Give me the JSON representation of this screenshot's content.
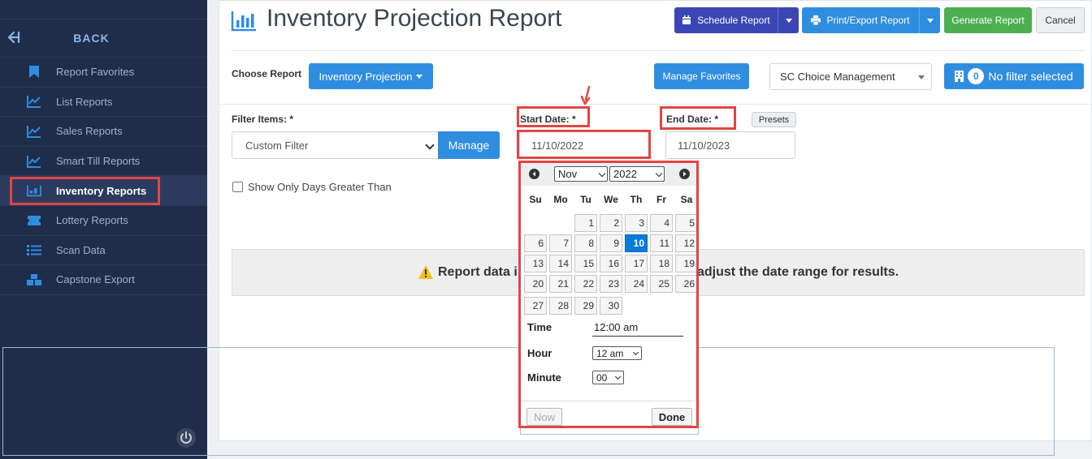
{
  "sidebar": {
    "back_label": "BACK",
    "items": [
      {
        "label": "Report Favorites",
        "icon": "bookmark-icon"
      },
      {
        "label": "List Reports",
        "icon": "line-chart-icon"
      },
      {
        "label": "Sales Reports",
        "icon": "line-chart-icon"
      },
      {
        "label": "Smart Till Reports",
        "icon": "line-chart-icon"
      },
      {
        "label": "Inventory Reports",
        "icon": "inventory-icon",
        "active": true
      },
      {
        "label": "Lottery Reports",
        "icon": "ticket-icon"
      },
      {
        "label": "Scan Data",
        "icon": "list-icon"
      },
      {
        "label": "Capstone Export",
        "icon": "boxes-icon"
      }
    ]
  },
  "header": {
    "title": "Inventory Projection Report",
    "schedule_label": "Schedule Report",
    "print_label": "Print/Export Report",
    "generate_label": "Generate Report",
    "cancel_label": "Cancel"
  },
  "report_bar": {
    "choose_label": "Choose Report",
    "report_value": "Inventory Projection",
    "favorites_label": "Manage Favorites",
    "store_value": "SC Choice Management",
    "filter_count": "0",
    "filter_label": "No filter selected"
  },
  "filters": {
    "filter_items_label": "Filter Items: *",
    "filter_value": "Custom Filter",
    "manage_label": "Manage",
    "start_label": "Start Date: *",
    "start_value": "11/10/2022",
    "end_label": "End Date: *",
    "end_value": "11/10/2023",
    "presets_label": "Presets",
    "show_only_label": "Show Only Days Greater Than"
  },
  "alert": {
    "text_left": "Report data i",
    "text_right": "adjust the date range for results."
  },
  "datepicker": {
    "month": "Nov",
    "year": "2022",
    "weekdays": [
      "Su",
      "Mo",
      "Tu",
      "We",
      "Th",
      "Fr",
      "Sa"
    ],
    "days": [
      "1",
      "2",
      "3",
      "4",
      "5",
      "6",
      "7",
      "8",
      "9",
      "10",
      "11",
      "12",
      "13",
      "14",
      "15",
      "16",
      "17",
      "18",
      "19",
      "20",
      "21",
      "22",
      "23",
      "24",
      "25",
      "26",
      "27",
      "28",
      "29",
      "30"
    ],
    "selected_day": "10",
    "time_label": "Time",
    "time_value": "12:00 am",
    "hour_label": "Hour",
    "hour_value": "12 am",
    "minute_label": "Minute",
    "minute_value": "00",
    "now_label": "Now",
    "done_label": "Done"
  },
  "colors": {
    "sidebar_bg": "#1f2d4b",
    "primary": "#2f8de0",
    "schedule": "#3b46b5",
    "generate": "#4cb050",
    "highlight": "#e24545",
    "selected_day": "#0a7bd8"
  }
}
